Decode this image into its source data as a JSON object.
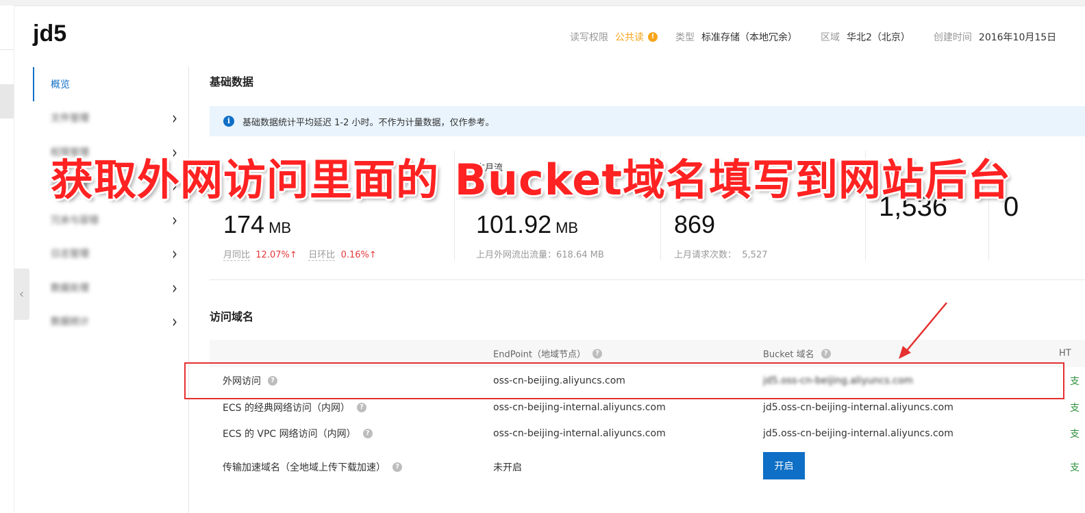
{
  "bucket": {
    "name": "jd5",
    "meta": {
      "perm_label": "读写权限",
      "perm_value": "公共读",
      "type_label": "类型",
      "type_value": "标准存储（本地冗余）",
      "region_label": "区域",
      "region_value": "华北2（北京）",
      "created_label": "创建时间",
      "created_value": "2016年10月15日"
    }
  },
  "sidebar": {
    "items": [
      {
        "label": "概览"
      },
      {
        "label": "文件管理"
      },
      {
        "label": "权限管理"
      },
      {
        "label": "基础设置"
      },
      {
        "label": "冗余与容错"
      },
      {
        "label": "日志管理"
      },
      {
        "label": "数据处理"
      },
      {
        "label": "数据统计"
      }
    ]
  },
  "basic": {
    "title": "基础数据",
    "notice": "基础数据统计平均延迟 1-2 小时。不作为计量数据，仅作参考。",
    "stats": [
      {
        "value": "174",
        "unit": "MB",
        "mom_label": "月同比",
        "mom_value": "12.07%↑",
        "dod_label": "日环比",
        "dod_value": "0.16%↑"
      },
      {
        "label": "本月流",
        "value": "101.92",
        "unit": "MB",
        "sub_label": "上月外网流出流量：",
        "sub_value": "618.64 MB"
      },
      {
        "value": "869",
        "sub_label": "上月请求次数：",
        "sub_value": "5,527"
      },
      {
        "value": "1,536"
      },
      {
        "value": "0"
      }
    ]
  },
  "domains": {
    "title": "访问域名",
    "headers": {
      "endpoint": "EndPoint（地域节点）",
      "bucket": "Bucket 域名",
      "https": "HT"
    },
    "rows": [
      {
        "name": "外网访问",
        "endpoint": "oss-cn-beijing.aliyuncs.com",
        "bucket": "jd5.oss-cn-beijing.aliyuncs.com",
        "https": "支"
      },
      {
        "name": "ECS 的经典网络访问（内网）",
        "endpoint": "oss-cn-beijing-internal.aliyuncs.com",
        "bucket": "jd5.oss-cn-beijing-internal.aliyuncs.com",
        "https": "支"
      },
      {
        "name": "ECS 的 VPC 网络访问（内网）",
        "endpoint": "oss-cn-beijing-internal.aliyuncs.com",
        "bucket": "jd5.oss-cn-beijing-internal.aliyuncs.com",
        "https": "支"
      },
      {
        "name": "传输加速域名（全地域上传下载加速）",
        "endpoint": "未开启",
        "button": "开启",
        "https": "支"
      }
    ]
  },
  "annotation": {
    "text": "获取外网访问里面的 Bucket域名填写到网站后台",
    "color": "#ff2222"
  },
  "colors": {
    "accent": "#0f6fc6",
    "warn": "#f7a51b",
    "danger": "#e53030",
    "notice_bg": "#e9f4fd"
  }
}
